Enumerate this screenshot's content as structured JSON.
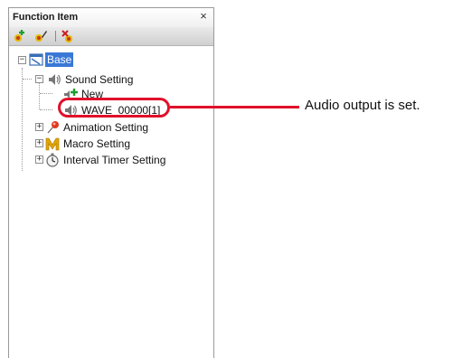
{
  "panel": {
    "title": "Function Item",
    "close_glyph": "×"
  },
  "toolbar": {
    "buttons": [
      {
        "icon": "add-item-icon"
      },
      {
        "icon": "edit-item-icon"
      },
      {
        "icon": "delete-item-icon"
      }
    ]
  },
  "tree": {
    "root": {
      "label": "Base",
      "expander": "−",
      "selected": true
    },
    "sound_setting": {
      "label": "Sound Setting",
      "expander": "−"
    },
    "new_item": {
      "label": "New"
    },
    "wave_item": {
      "label": "WAVE_00000[1]"
    },
    "animation_setting": {
      "label": "Animation Setting",
      "expander": "+"
    },
    "macro_setting": {
      "label": "Macro Setting",
      "expander": "+"
    },
    "interval_timer_setting": {
      "label": "Interval Timer Setting",
      "expander": "+"
    }
  },
  "callout": {
    "text": "Audio output is set.",
    "color": "#e0102a"
  },
  "colors": {
    "selection": "#3a78d6",
    "border": "#9a9a9a"
  }
}
